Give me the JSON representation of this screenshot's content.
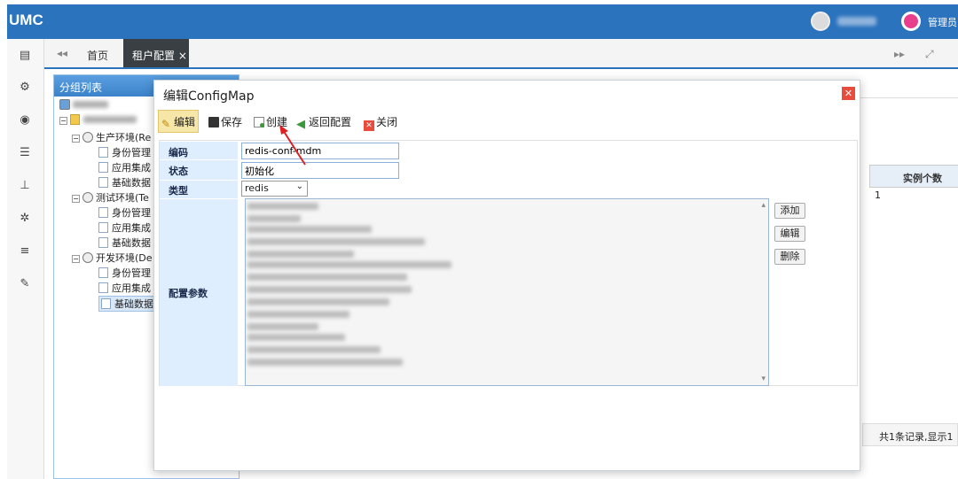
{
  "app": {
    "logo": "UMC",
    "admin_label": "管理员"
  },
  "tabs": {
    "home": "首页",
    "active": "租户配置 ×",
    "nav_left": "◂◂",
    "nav_right": "▸▸",
    "fullscreen": "⤢"
  },
  "tree": {
    "header": "分组列表",
    "envs": [
      {
        "label": "生产环境(Re",
        "children": [
          "身份管理",
          "应用集成",
          "基础数据"
        ]
      },
      {
        "label": "测试环境(Te",
        "children": [
          "身份管理",
          "应用集成",
          "基础数据"
        ]
      },
      {
        "label": "开发环境(De",
        "children": [
          "身份管理",
          "应用集成",
          "基础数据"
        ]
      }
    ]
  },
  "background_table": {
    "col_header": "实例个数",
    "cell": "1",
    "footer": "共1条记录,显示1"
  },
  "dialog": {
    "title": "编辑ConfigMap",
    "toolbar": {
      "edit": "编辑",
      "save": "保存",
      "create": "创建",
      "back": "返回配置",
      "close": "关闭"
    },
    "form": {
      "code_label": "编码",
      "code_value": "redis-conf-mdm",
      "status_label": "状态",
      "status_value": "初始化",
      "type_label": "类型",
      "type_value": "redis",
      "params_label": "配置参数"
    },
    "side_buttons": {
      "add": "添加",
      "edit": "编辑",
      "delete": "删除"
    }
  },
  "colors": {
    "brand": "#2b73bd",
    "label_bg": "#dfeeff",
    "close_red": "#e84c3d"
  },
  "icons": [
    "user-avatar-icon",
    "location-pin-icon",
    "id-card-icon",
    "gears-icon",
    "eye-icon",
    "list-icon",
    "sitemap-icon",
    "gear-icon",
    "menu-icon",
    "wrench-icon",
    "pencil-icon",
    "floppy-icon",
    "new-doc-icon",
    "back-arrow-icon",
    "close-icon"
  ]
}
